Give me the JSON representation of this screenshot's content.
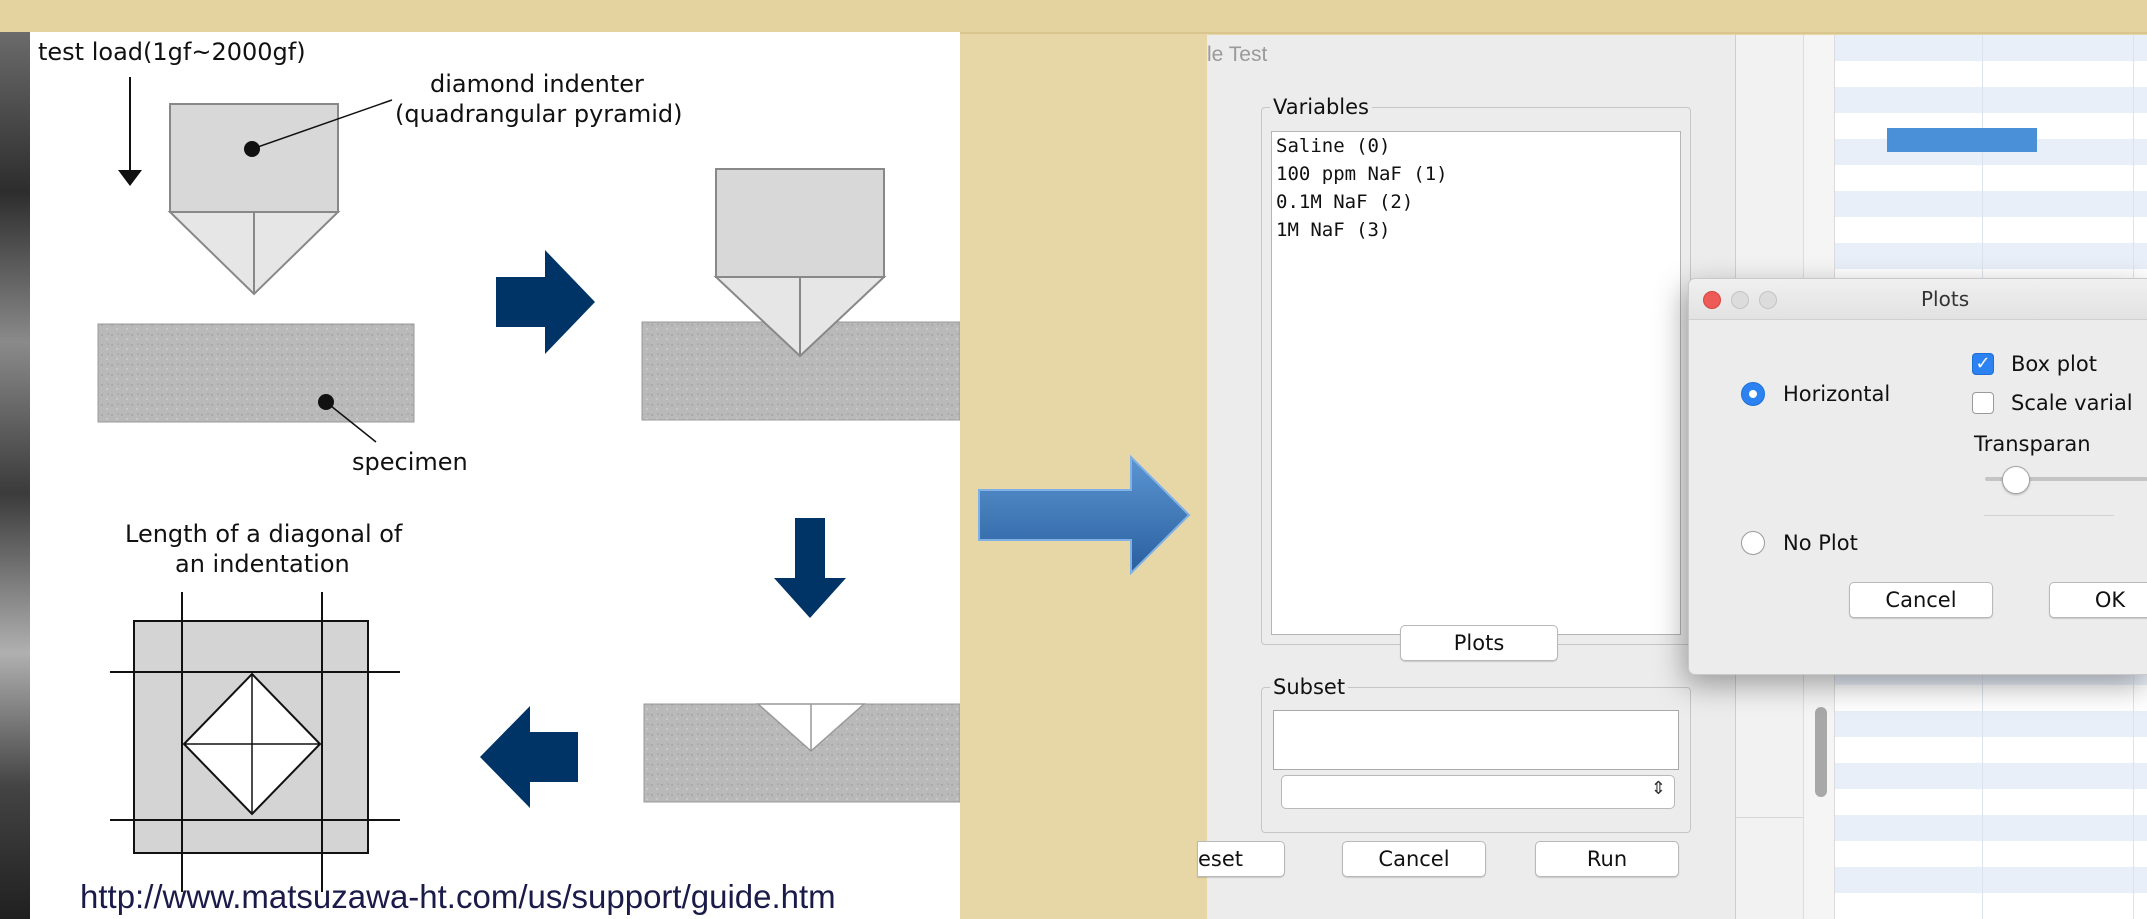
{
  "diagram": {
    "load_label": "test load(1gf~2000gf)",
    "indenter_label_line1": "diamond indenter",
    "indenter_label_line2": "(quadrangular pyramid)",
    "specimen_label": "specimen",
    "diagonal_label_line1": "Length of a diagonal of",
    "diagonal_label_line2": "an indentation",
    "source_url": "http://www.matsuzawa-ht.com/us/support/guide.htm",
    "arrow_color": "#003466"
  },
  "dialog": {
    "title_fragment": "le Test",
    "variables_legend": "Variables",
    "variables": [
      "Saline (0)",
      "100 ppm NaF (1)",
      "0.1M NaF (2)",
      "1M NaF (3)"
    ],
    "plots_button": "Plots",
    "subset_legend": "Subset",
    "subset_value": "",
    "reset_button": "eset",
    "cancel_button": "Cancel",
    "run_button": "Run"
  },
  "plots_dialog": {
    "title": "Plots",
    "horizontal_label": "Horizontal",
    "horizontal_selected": true,
    "box_plot_label": "Box plot",
    "box_plot_checked": true,
    "scale_label": "Scale varial",
    "scale_checked": false,
    "transparency_label": "Transparan",
    "transparency_level": 0.1,
    "no_plot_label": "No Plot",
    "no_plot_selected": false,
    "cancel_button": "Cancel",
    "ok_button": "OK"
  },
  "colors": {
    "background": "#e8d7a6",
    "transition_arrow": "#3d78b8",
    "accent_blue": "#2b82f0",
    "sheet_bar": "#4a90d9"
  }
}
